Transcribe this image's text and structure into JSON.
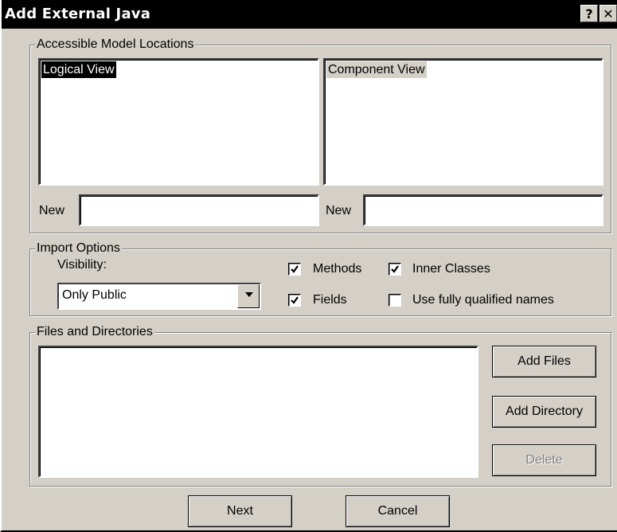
{
  "window": {
    "title": "Add External Java",
    "help_label": "?",
    "close_label": "✕"
  },
  "locations": {
    "group_label": "Accessible Model Locations",
    "left_list": {
      "items": [
        "Logical View"
      ],
      "selected": "Logical View"
    },
    "right_list": {
      "items": [
        "Component View"
      ],
      "selected": "Component View"
    },
    "new_left_label": "New",
    "new_left_value": "",
    "new_right_label": "New",
    "new_right_value": ""
  },
  "import_options": {
    "group_label": "Import Options",
    "visibility_label": "Visibility:",
    "visibility_value": "Only Public",
    "methods": {
      "label": "Methods",
      "checked": true
    },
    "inner_classes": {
      "label": "Inner Classes",
      "checked": true
    },
    "fields": {
      "label": "Fields",
      "checked": true
    },
    "fully_qualified": {
      "label": "Use fully qualified names",
      "checked": false
    }
  },
  "files": {
    "group_label": "Files and Directories",
    "items": [],
    "add_files_label": "Add Files",
    "add_directory_label": "Add Directory",
    "delete_label": "Delete",
    "delete_enabled": false
  },
  "footer": {
    "next_label": "Next",
    "cancel_label": "Cancel"
  },
  "colors": {
    "face": "#d4d0c8",
    "title_bg": "#000000",
    "selection": "#000000"
  }
}
